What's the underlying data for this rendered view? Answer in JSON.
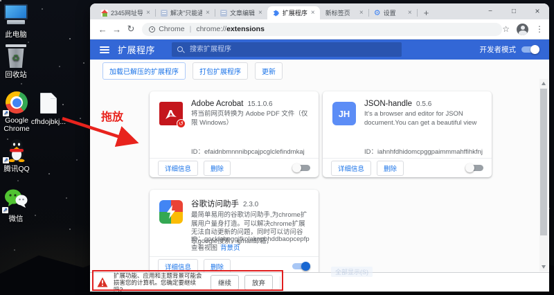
{
  "colors": {
    "header-blue": "#3367d6",
    "accent": "#1a73e8",
    "annotation-red": "#e01e1e",
    "warning-red": "#d93025",
    "toggle-on": "#1967d2"
  },
  "desktop": {
    "icons": [
      {
        "label": "此电脑",
        "icon": "this-pc-icon",
        "shortcut": false
      },
      {
        "label": "回收站",
        "icon": "recycle-bin-icon",
        "shortcut": false
      },
      {
        "label": "Google Chrome",
        "icon": "chrome-icon",
        "shortcut": true
      },
      {
        "label": "cfhdojbkj...",
        "icon": "file-icon",
        "shortcut": false
      },
      {
        "label": "腾讯QQ",
        "icon": "qq-icon",
        "shortcut": true
      },
      {
        "label": "微信",
        "icon": "wechat-icon",
        "shortcut": true
      }
    ]
  },
  "annotations": {
    "drag_label": "拖放"
  },
  "browser": {
    "tabs": [
      {
        "title": "2345网址导",
        "icon": "2345-favicon"
      },
      {
        "title": "解决\"只能通",
        "icon": "doc-favicon"
      },
      {
        "title": "文章编辑",
        "icon": "doc-favicon"
      },
      {
        "title": "扩展程序",
        "icon": "puzzle-favicon",
        "active": true
      },
      {
        "title": "新标签页",
        "icon": "none"
      },
      {
        "title": "设置",
        "icon": "gear-favicon"
      }
    ],
    "url_chip": "Chrome",
    "url_separator": "|",
    "url_scheme": "chrome://",
    "url_host": "extensions"
  },
  "extensions_page": {
    "title": "扩展程序",
    "search_placeholder": "搜索扩展程序",
    "dev_mode_label": "开发者模式",
    "dev_mode_on": true,
    "toolbar_buttons": [
      {
        "label": "加载已解压的扩展程序"
      },
      {
        "label": "打包扩展程序"
      },
      {
        "label": "更新"
      }
    ],
    "cards": [
      {
        "name": "Adobe Acrobat",
        "version": "15.1.0.6",
        "description": "将当前网页转换为 Adobe PDF 文件（仅限 Windows）",
        "id_label": "ID：",
        "id": "efaidnbmnnnibpcajpcglclefindmkaj",
        "details_label": "详细信息",
        "remove_label": "删除",
        "enabled": false
      },
      {
        "name": "JSON-handle",
        "version": "0.5.6",
        "icon_text": "JH",
        "description": "It's a browser and editor for JSON document.You can get a beautiful view",
        "id_label": "ID：",
        "id": "iahnhfdhidomcpggpaimmmahffihkfnj",
        "details_label": "详细信息",
        "remove_label": "删除",
        "enabled": false
      },
      {
        "name": "谷歌访问助手",
        "version": "2.3.0",
        "description": "最简单易用的谷歌访问助手,为chrome扩展用户量身打造。可以解决chrome扩展无法自动更新的问题，同时可以访问谷歌google搜索，gmail邮箱，",
        "id_label": "ID：",
        "id": "gocklaboggjfkolaknpbhddbaopcepfp",
        "views_label": "查看视图",
        "views_link": "背景页",
        "details_label": "详细信息",
        "remove_label": "删除",
        "enabled": true
      }
    ]
  },
  "download_shelf": {
    "warning_text": "扩展功能、应用和主题背景可能会损害您的计算机。您确定要继续吗?",
    "continue_label": "继续",
    "discard_label": "放弃",
    "show_all_label": "全部显示(S)"
  }
}
